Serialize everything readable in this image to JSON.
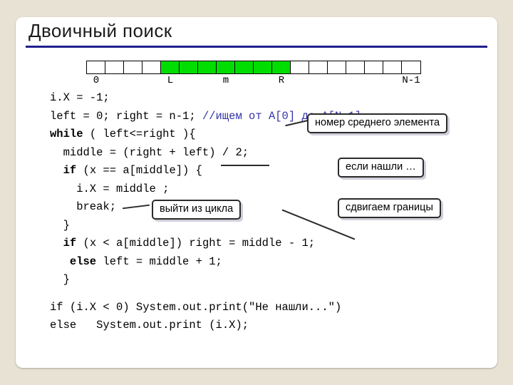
{
  "slide": {
    "title": "Двоичный поиск",
    "accent_color": "#1f1f8c",
    "highlight_color": "#00dd00",
    "background_color": "#e8e2d4",
    "card_color": "#ffffff"
  },
  "array_diagram": {
    "total_cells": 18,
    "highlight_start_index": 4,
    "highlight_end_index": 10,
    "labels": [
      {
        "text": "0",
        "index": 0
      },
      {
        "text": "L",
        "index": 4
      },
      {
        "text": "m",
        "index": 7
      },
      {
        "text": "R",
        "index": 10
      },
      {
        "text": "N-1",
        "index": 17
      }
    ]
  },
  "code": {
    "lines": [
      {
        "id": "l1",
        "segments": [
          {
            "t": "i.X = -1;",
            "style": "plain"
          }
        ]
      },
      {
        "id": "l2",
        "segments": [
          {
            "t": "left = 0; right = n-1; ",
            "style": "plain"
          },
          {
            "t": "//ищем от A[0] до A[N-1]",
            "style": "comment"
          }
        ]
      },
      {
        "id": "l3",
        "segments": [
          {
            "t": "while",
            "style": "keyword"
          },
          {
            "t": " ( left<=right ){",
            "style": "plain"
          }
        ]
      },
      {
        "id": "l4",
        "segments": [
          {
            "t": "  middle = (right + left) / 2;",
            "style": "plain"
          }
        ]
      },
      {
        "id": "l5",
        "segments": [
          {
            "t": "  ",
            "style": "plain"
          },
          {
            "t": "if",
            "style": "keyword"
          },
          {
            "t": " (x == a[middle]) {",
            "style": "plain"
          }
        ]
      },
      {
        "id": "l6",
        "segments": [
          {
            "t": "    i.X = middle ;",
            "style": "plain"
          }
        ]
      },
      {
        "id": "l7",
        "segments": [
          {
            "t": "    break;",
            "style": "plain"
          }
        ]
      },
      {
        "id": "l8",
        "segments": [
          {
            "t": "  }",
            "style": "plain"
          }
        ]
      },
      {
        "id": "l9",
        "segments": [
          {
            "t": "  ",
            "style": "plain"
          },
          {
            "t": "if",
            "style": "keyword"
          },
          {
            "t": " (x < a[middle]) right = middle - 1;",
            "style": "plain"
          }
        ]
      },
      {
        "id": "l10",
        "segments": [
          {
            "t": "   ",
            "style": "plain"
          },
          {
            "t": "else",
            "style": "keyword"
          },
          {
            "t": " left = middle + 1;",
            "style": "plain"
          }
        ]
      },
      {
        "id": "l11",
        "segments": [
          {
            "t": "  }",
            "style": "plain"
          }
        ]
      },
      {
        "id": "gap",
        "segments": []
      },
      {
        "id": "l12",
        "segments": [
          {
            "t": "if (i.X < 0) System.out.print(\"Не нашли...\")",
            "style": "plain"
          }
        ]
      },
      {
        "id": "l13",
        "segments": [
          {
            "t": "else   System.out.print (i.X);",
            "style": "plain"
          }
        ]
      }
    ]
  },
  "callouts": [
    {
      "id": "middle-index",
      "text": "номер среднего элемента"
    },
    {
      "id": "found",
      "text": "если нашли …"
    },
    {
      "id": "break-loop",
      "text": "выйти из цикла"
    },
    {
      "id": "shift-bounds",
      "text": "сдвигаем границы"
    }
  ]
}
